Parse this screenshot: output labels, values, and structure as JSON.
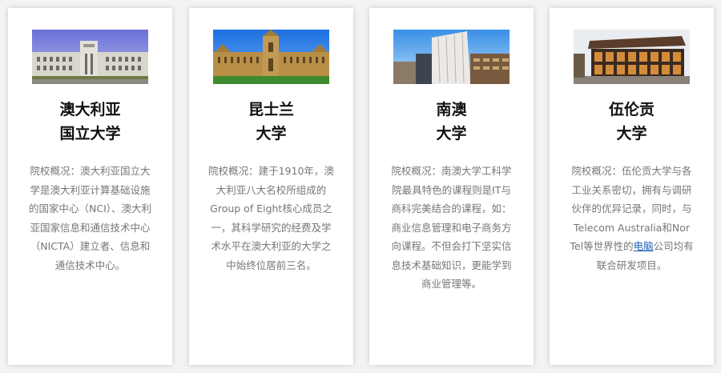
{
  "cards": [
    {
      "title_line1": "澳大利亚",
      "title_line2": "国立大学",
      "description": "院校概况：澳大利亚国立大学是澳大利亚计算基础设施的国家中心（NCI）、澳大利亚国家信息和通信技术中心（NICTA）建立者、信息和通信技术中心。",
      "image": "university-building-photo"
    },
    {
      "title_line1": "昆士兰",
      "title_line2": "大学",
      "description": "院校概况：建于1910年，澳大利亚八大名校所组成的Group of Eight核心成员之一，其科学研究的经费及学术水平在澳大利亚的大学之中始终位居前三名。",
      "image": "sandstone-quadrangle-photo"
    },
    {
      "title_line1": "南澳",
      "title_line2": "大学",
      "description": "院校概况：南澳大学工科学院最具特色的课程则是IT与商科完美结合的课程，如：商业信息管理和电子商务方向课程。不但会打下坚实信息技术基础知识，更能学到商业管理等。",
      "image": "modern-building-photo"
    },
    {
      "title_line1": "伍伦贡",
      "title_line2": "大学",
      "description_before_link": "院校概况：伍伦贡大学与各工业关系密切，拥有与调研伙伴的优异记录，同时，与Telecom Australia和Nor Tel等世界性的",
      "description_link": "电脑",
      "description_after_link": "公司均有联合研发项目。",
      "image": "glass-building-photo"
    }
  ],
  "colors": {
    "title": "#111111",
    "description": "#777777",
    "link": "#1a5fb4",
    "card_bg": "#ffffff",
    "page_bg": "#f3f3f3"
  }
}
